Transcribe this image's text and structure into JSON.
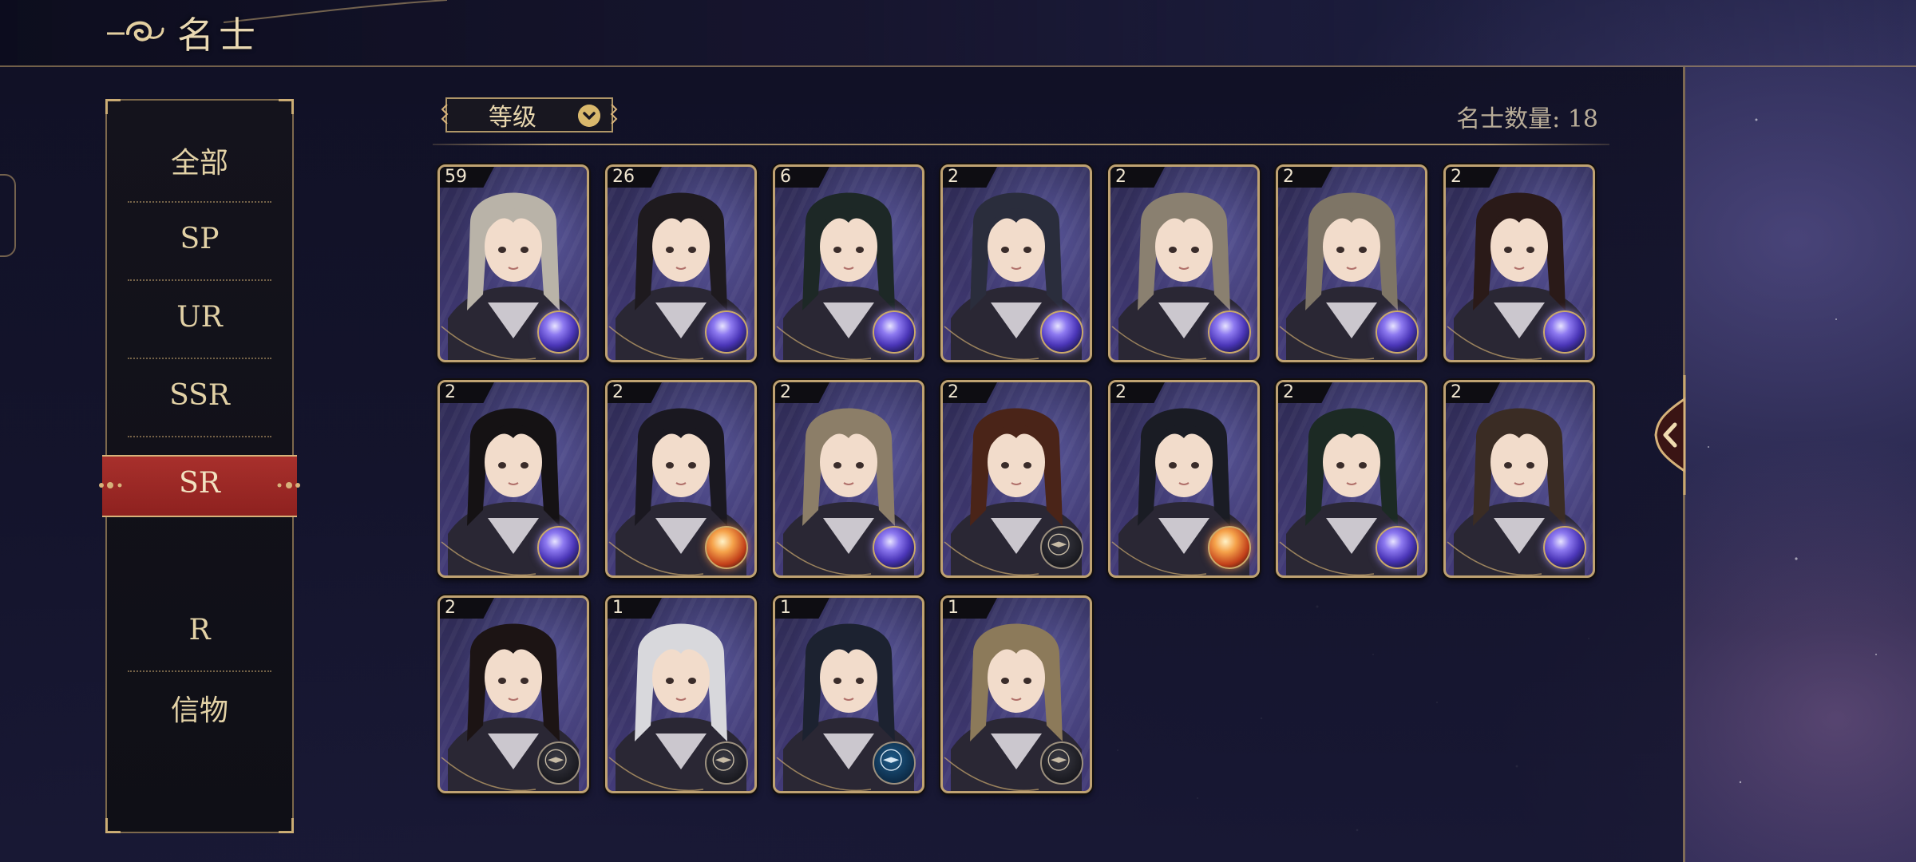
{
  "header": {
    "title": "名士",
    "icon": "cloud-swirl-icon"
  },
  "sidebar": {
    "items": [
      {
        "label": "全部",
        "active": false
      },
      {
        "label": "SP",
        "active": false
      },
      {
        "label": "UR",
        "active": false
      },
      {
        "label": "SSR",
        "active": false
      },
      {
        "label": "SR",
        "active": true
      },
      {
        "label": "R",
        "active": false
      },
      {
        "label": "信物",
        "active": false
      }
    ]
  },
  "sort": {
    "label": "等级",
    "icon": "chevron-down-icon"
  },
  "count": {
    "text": "名士数量: 18"
  },
  "cards": [
    {
      "level": "59",
      "orb": "blue-orb-icon",
      "hair": "#b9b3a8"
    },
    {
      "level": "26",
      "orb": "blue-orb-icon",
      "hair": "#1e1a1e"
    },
    {
      "level": "6",
      "orb": "blue-orb-icon",
      "hair": "#1d2826"
    },
    {
      "level": "2",
      "orb": "blue-orb-icon",
      "hair": "#2a2d3c"
    },
    {
      "level": "2",
      "orb": "blue-orb-icon",
      "hair": "#8a8070"
    },
    {
      "level": "2",
      "orb": "blue-orb-icon",
      "hair": "#7e7566"
    },
    {
      "level": "2",
      "orb": "blue-orb-icon",
      "hair": "#2a1a18"
    },
    {
      "level": "2",
      "orb": "blue-orb-icon",
      "hair": "#151214"
    },
    {
      "level": "2",
      "orb": "orange-orb-icon",
      "hair": "#1a1820"
    },
    {
      "level": "2",
      "orb": "blue-orb-icon",
      "hair": "#8c7e68"
    },
    {
      "level": "2",
      "orb": "compass-icon",
      "hair": "#4a2418"
    },
    {
      "level": "2",
      "orb": "orange-orb-icon",
      "hair": "#1a1c24"
    },
    {
      "level": "2",
      "orb": "blue-orb-icon",
      "hair": "#1c2a24"
    },
    {
      "level": "2",
      "orb": "blue-orb-icon",
      "hair": "#3a2c24"
    },
    {
      "level": "2",
      "orb": "compass-icon",
      "hair": "#1c1414"
    },
    {
      "level": "1",
      "orb": "compass-icon",
      "hair": "#d8d8dc"
    },
    {
      "level": "1",
      "orb": "teal-compass-icon",
      "hair": "#1c2230"
    },
    {
      "level": "1",
      "orb": "compass-icon",
      "hair": "#8c7a5a"
    }
  ],
  "colors": {
    "accent_gold": "#d6b27a",
    "active_red": "#a8302c",
    "text_cream": "#e3d2a6"
  }
}
